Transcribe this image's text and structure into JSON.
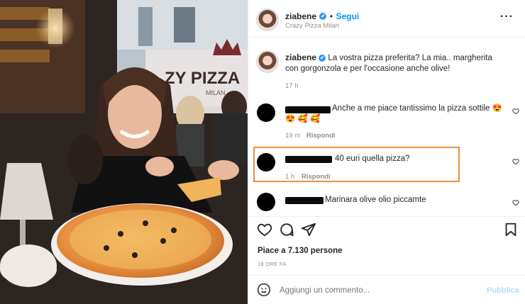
{
  "post": {
    "username": "ziabene",
    "verified_mark": "✔",
    "separator": "•",
    "follow_label": "Segui",
    "location": "Crazy Pizza Milan",
    "more_icon": "more-dots-icon"
  },
  "caption": {
    "username": "ziabene",
    "text": "La vostra pizza preferita? La mia.. margherita con gorgonzola e per l'occasione anche olive!",
    "time": "17 h"
  },
  "comments": [
    {
      "text": "Anche a me piace tantissimo la pizza sottile 😍",
      "text2": "😍 🥰 🥰",
      "time": "19 m",
      "reply": "Rispondi"
    },
    {
      "text": "40 euri quella pizza?",
      "time": "1 h",
      "reply": "Rispondi"
    },
    {
      "text": "Marinara olive olio piccamte"
    }
  ],
  "actions": {
    "likes": "Piace a 7.130 persone",
    "date": "18 ORE FA"
  },
  "composer": {
    "placeholder": "Aggiungi un commento...",
    "publish": "Pubblica"
  },
  "photo_sign": {
    "text": "ZY PIZZA",
    "sub": "MILAN"
  },
  "colors": {
    "accent": "#0095f6",
    "highlight": "#e8903d"
  }
}
